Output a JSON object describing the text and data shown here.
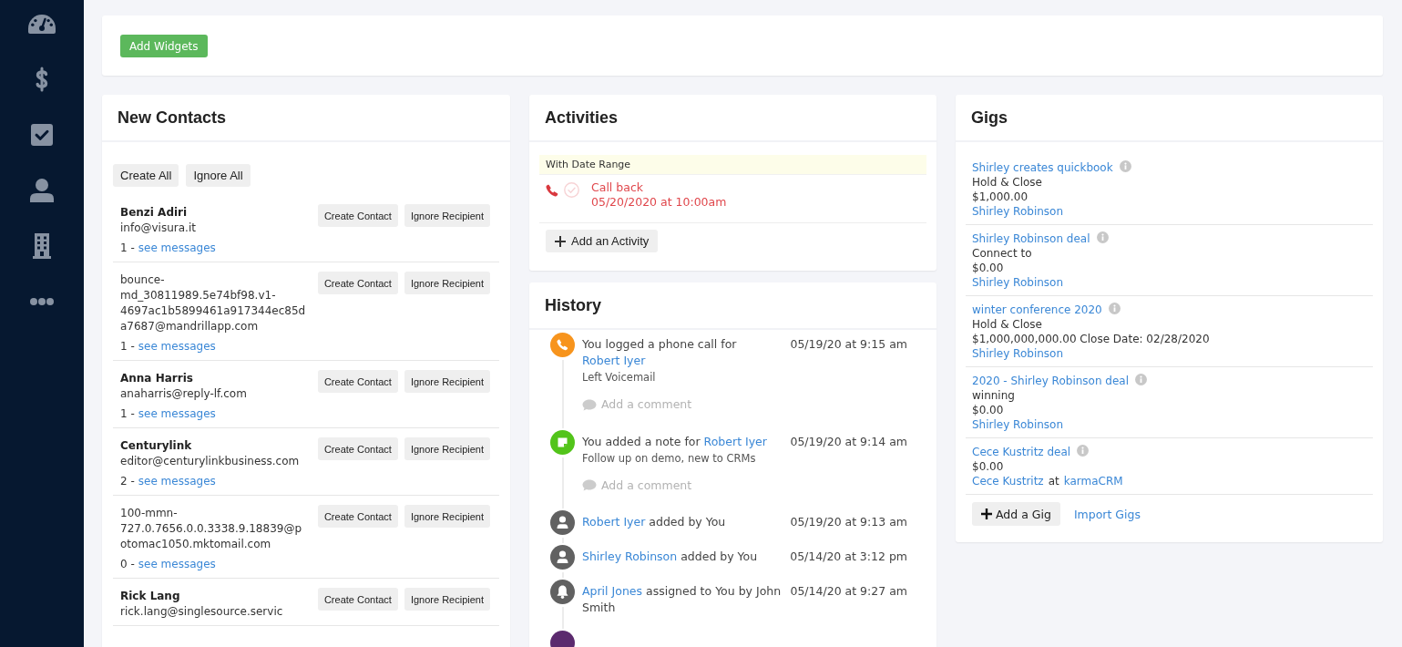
{
  "sidebar": {
    "items": [
      {
        "kind": "dashboard"
      },
      {
        "kind": "money"
      },
      {
        "kind": "tasks"
      },
      {
        "kind": "contacts"
      },
      {
        "kind": "companies"
      },
      {
        "kind": "more"
      }
    ]
  },
  "toolbar": {
    "add_widgets_button": "Add Widgets"
  },
  "new_contacts": {
    "title": "New Contacts",
    "bulk_buttons": [
      "Create All",
      "Ignore All"
    ],
    "contacts": [
      {
        "name": "Benzi Adiri",
        "email": "info@visura.it",
        "count": "1 -",
        "link": "see messages",
        "buttons": [
          "Create Contact",
          "Ignore Recipient"
        ]
      },
      {
        "email": "bounce-md_30811989.5e74bf98.v1-4697ac1b5899461a917344ec85da7687@mandrillapp.com",
        "count": "1 -",
        "link": "see messages",
        "buttons": [
          "Create Contact",
          "Ignore Recipient"
        ]
      },
      {
        "name": "Anna Harris",
        "email": "anaharris@reply-lf.com",
        "count": "1 -",
        "link": "see messages",
        "buttons": [
          "Create Contact",
          "Ignore Recipient"
        ]
      },
      {
        "name": "Centurylink",
        "email": "editor@centurylinkbusiness.com",
        "count": "2 -",
        "link": "see messages",
        "buttons": [
          "Create Contact",
          "Ignore Recipient"
        ]
      },
      {
        "email": "100-mmn-727.0.7656.0.0.3338.9.18839@potomac1050.mktomail.com",
        "count": "0 -",
        "link": "see messages",
        "buttons": [
          "Create Contact",
          "Ignore Recipient"
        ]
      },
      {
        "name": "Rick Lang",
        "email": "rick.lang@singlesource.servic",
        "buttons": [
          "Create Contact",
          "Ignore Recipient"
        ]
      }
    ]
  },
  "activities": {
    "title": "Activities",
    "filter_label": "With Date Range",
    "items": [
      {
        "kind": "call",
        "title": "Call back",
        "due": "05/20/2020 at 10:00am",
        "overdue": true,
        "completed": false
      }
    ],
    "add_button": "Add an Activity"
  },
  "history": {
    "title": "History",
    "items": [
      {
        "kind": "call",
        "color": "#f7941d",
        "parts": [
          {
            "kind": "text",
            "text": "You logged a phone call for"
          },
          {
            "kind": "link",
            "text": "Robert Iyer"
          }
        ],
        "date": "05/19/20 at 9:15 am",
        "detail": "Left Voicemail",
        "comment_prompt": "Add a comment"
      },
      {
        "kind": "note",
        "color": "#52c41a",
        "parts": [
          {
            "kind": "text",
            "text": "You added a note for"
          },
          {
            "kind": "link",
            "text": "Robert Iyer"
          }
        ],
        "date": "05/19/20 at 9:14 am",
        "detail": "Follow up on demo, new to CRMs",
        "comment_prompt": "Add a comment"
      },
      {
        "kind": "contact",
        "color": "#616161",
        "parts": [
          {
            "kind": "link",
            "text": "Robert Iyer"
          },
          {
            "kind": "text",
            "text": "added by You"
          }
        ],
        "date": "05/19/20 at 9:13 am"
      },
      {
        "kind": "contact",
        "color": "#616161",
        "parts": [
          {
            "kind": "link",
            "text": "Shirley Robinson"
          },
          {
            "kind": "text",
            "text": "added by You"
          }
        ],
        "date": "05/14/20 at 3:12 pm"
      },
      {
        "kind": "assignment",
        "color": "#616161",
        "parts": [
          {
            "kind": "link",
            "text": "April Jones"
          },
          {
            "kind": "text",
            "text": "assigned to You by John Smith"
          }
        ],
        "date": "05/14/20 at 9:27 am"
      },
      {
        "kind": "other",
        "color": "#5b2a6e"
      }
    ]
  },
  "gigs": {
    "title": "Gigs",
    "items": [
      {
        "title": "Shirley creates quickbook",
        "stage": "Hold & Close",
        "amount": "$1,000.00",
        "contact": "Shirley Robinson"
      },
      {
        "title": "Shirley Robinson deal",
        "stage": "Connect to",
        "amount": "$0.00",
        "contact": "Shirley Robinson"
      },
      {
        "title": "winter conference 2020",
        "stage": "Hold & Close",
        "amount": "$1,000,000,000.00 Close Date: 02/28/2020",
        "contact": "Shirley Robinson"
      },
      {
        "title": "2020 - Shirley Robinson deal",
        "stage": "winning",
        "amount": "$0.00",
        "contact": "Shirley Robinson"
      },
      {
        "title": "Cece Kustritz deal",
        "amount": "$0.00",
        "contact": "Cece Kustritz",
        "connector": "at",
        "company": "karmaCRM"
      }
    ],
    "add_button": "Add a Gig",
    "import_link": "Import Gigs"
  }
}
